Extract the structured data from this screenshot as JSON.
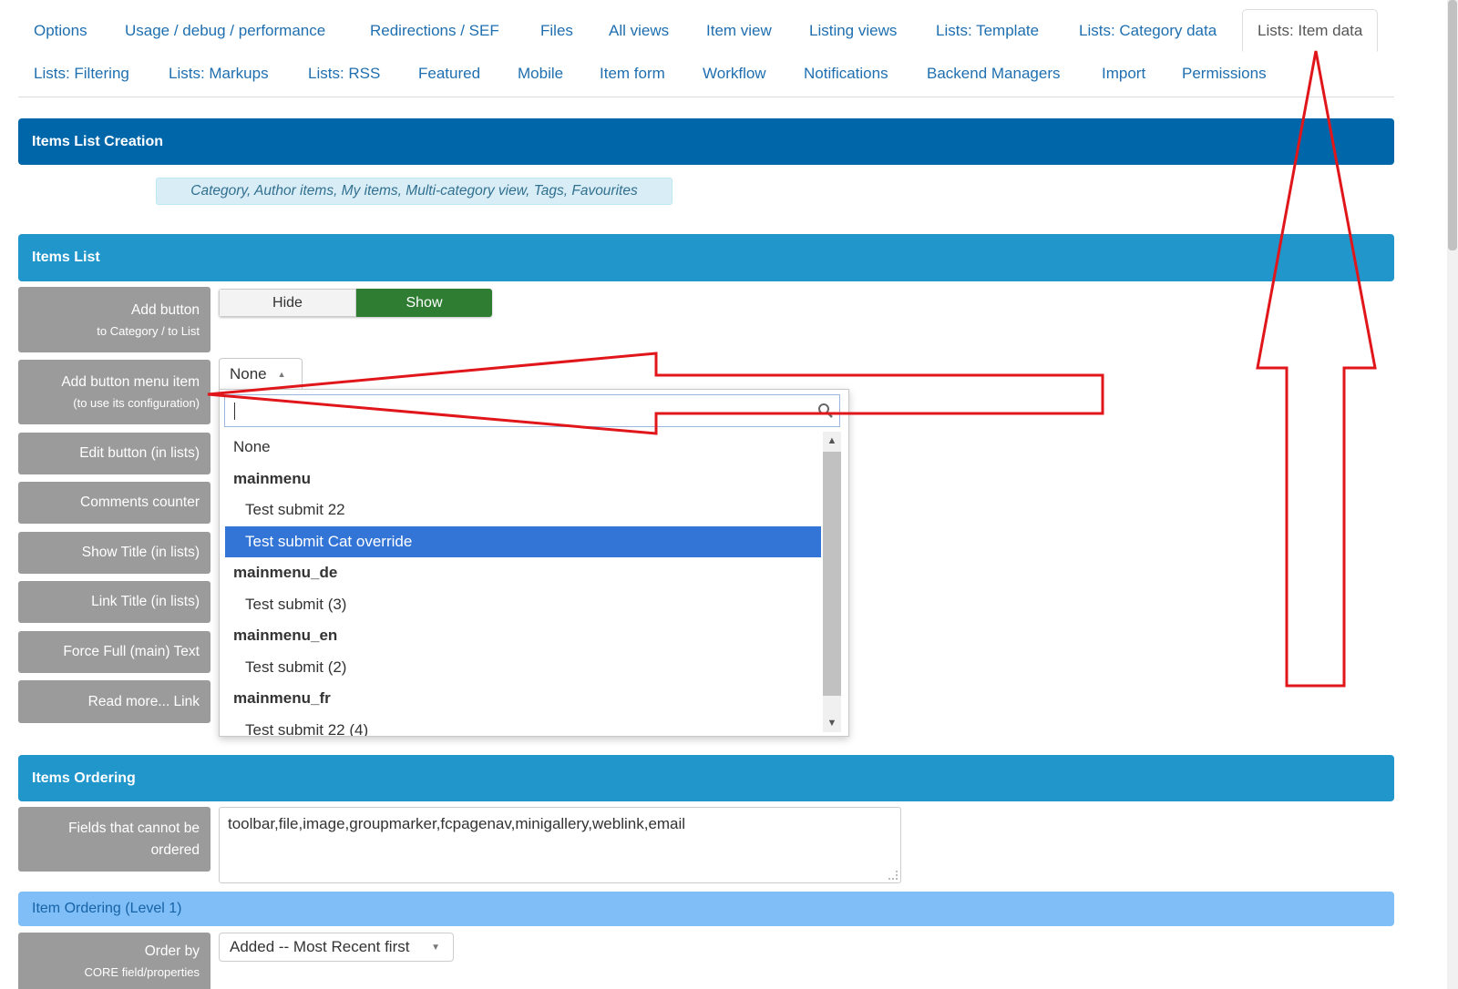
{
  "tabs_row1": [
    "Options",
    "Usage / debug / performance",
    "Redirections / SEF",
    "Files",
    "All views",
    "Item view",
    "Listing views",
    "Lists: Template",
    "Lists: Category data",
    "Lists: Item data"
  ],
  "tabs_row2": [
    "Lists: Filtering",
    "Lists: Markups",
    "Lists: RSS",
    "Featured",
    "Mobile",
    "Item form",
    "Workflow",
    "Notifications",
    "Backend Managers",
    "Import",
    "Permissions"
  ],
  "active_tab": "Lists: Item data",
  "sections": {
    "creation": "Items List Creation",
    "creation_note": "Category, Author items, My items, Multi-category view, Tags, Favourites",
    "items_list": "Items List",
    "ordering": "Items Ordering",
    "ordering_level1": "Item Ordering (Level 1)"
  },
  "fields": {
    "add_button": {
      "label": "Add button",
      "sub": "to Category / to List"
    },
    "add_button_menu": {
      "label": "Add button menu item",
      "sub": "(to use its configuration)"
    },
    "edit_button": {
      "label": "Edit button (in lists)"
    },
    "comments_counter": {
      "label": "Comments counter"
    },
    "show_title": {
      "label": "Show Title (in lists)"
    },
    "link_title": {
      "label": "Link Title (in lists)"
    },
    "force_full": {
      "label": "Force Full (main) Text"
    },
    "read_more": {
      "label": "Read more... Link"
    },
    "fields_cannot_order": {
      "label": "Fields that cannot be",
      "label2": "ordered"
    },
    "order_by": {
      "label": "Order by",
      "sub": "CORE field/properties"
    }
  },
  "toggle": {
    "hide": "Hide",
    "show": "Show",
    "selected": "Show"
  },
  "menu_select": {
    "value": "None",
    "search_value": ""
  },
  "dropdown_items": [
    {
      "text": "None",
      "kind": "option"
    },
    {
      "text": "mainmenu",
      "kind": "group"
    },
    {
      "text": "Test submit 22",
      "kind": "child"
    },
    {
      "text": "Test submit Cat override",
      "kind": "child",
      "highlighted": true
    },
    {
      "text": "mainmenu_de",
      "kind": "group"
    },
    {
      "text": "Test submit (3)",
      "kind": "child"
    },
    {
      "text": "mainmenu_en",
      "kind": "group"
    },
    {
      "text": "Test submit (2)",
      "kind": "child"
    },
    {
      "text": "mainmenu_fr",
      "kind": "group"
    },
    {
      "text": "Test submit 22 (4)",
      "kind": "child"
    }
  ],
  "non_orderable_fields": "toolbar,file,image,groupmarker,fcpagenav,minigallery,weblink,email",
  "order_by_value": "Added -- Most Recent first",
  "colors": {
    "tab_link": "#1f6fb0",
    "section_dark": "#0066aa",
    "section_mid": "#2196cb",
    "section_light": "#7fbef7",
    "label_bg": "#9b9b9b",
    "toggle_on": "#2f7d32",
    "highlight": "#3375d6",
    "annotation": "#e0161b"
  }
}
